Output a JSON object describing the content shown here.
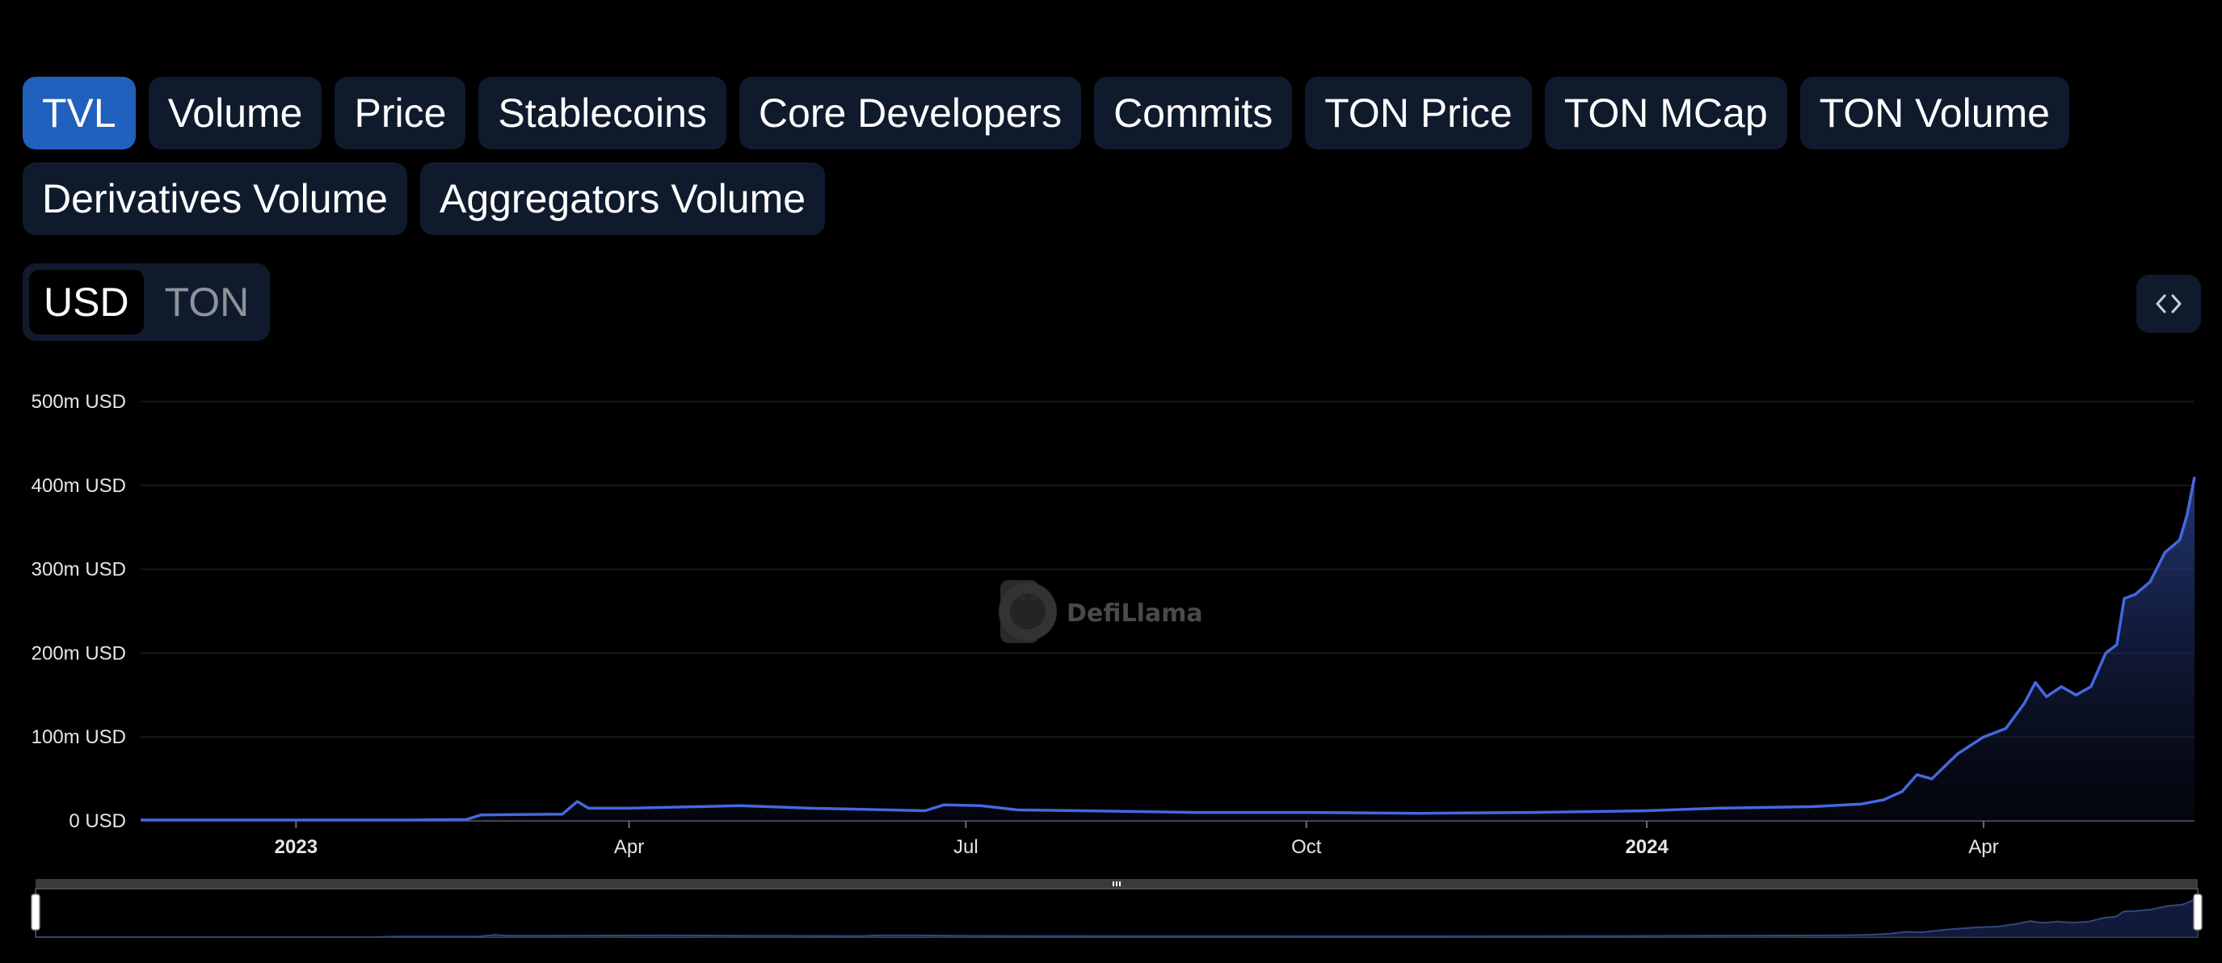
{
  "tabs": [
    {
      "label": "TVL",
      "active": true
    },
    {
      "label": "Volume",
      "active": false
    },
    {
      "label": "Price",
      "active": false
    },
    {
      "label": "Stablecoins",
      "active": false
    },
    {
      "label": "Core Developers",
      "active": false
    },
    {
      "label": "Commits",
      "active": false
    },
    {
      "label": "TON Price",
      "active": false
    },
    {
      "label": "TON MCap",
      "active": false
    },
    {
      "label": "TON Volume",
      "active": false
    },
    {
      "label": "Derivatives Volume",
      "active": false
    },
    {
      "label": "Aggregators Volume",
      "active": false
    }
  ],
  "unit_toggle": {
    "options": [
      "USD",
      "TON"
    ],
    "selected": "USD"
  },
  "embed_button": {
    "icon": "code-brackets-icon"
  },
  "watermark": {
    "text": "DefiLlama",
    "icon": "llama-logo-icon"
  },
  "colors": {
    "accent": "#2160bd",
    "line": "#4468e0",
    "tab_bg": "#0f1b2d",
    "grid": "#1f1f1f",
    "axis_text": "#e6e6e6"
  },
  "chart_data": {
    "type": "area",
    "title": "",
    "xlabel": "",
    "ylabel": "",
    "y_unit": "USD",
    "x_range": [
      "2022-11-20",
      "2024-05-28"
    ],
    "ylim": [
      0,
      500000000
    ],
    "y_ticks": [
      {
        "value": 0,
        "label": "0 USD"
      },
      {
        "value": 100000000,
        "label": "100m USD"
      },
      {
        "value": 200000000,
        "label": "200m USD"
      },
      {
        "value": 300000000,
        "label": "300m USD"
      },
      {
        "value": 400000000,
        "label": "400m USD"
      },
      {
        "value": 500000000,
        "label": "500m USD"
      }
    ],
    "x_ticks": [
      {
        "date": "2023-01-01",
        "label": "2023",
        "bold": true
      },
      {
        "date": "2023-04-01",
        "label": "Apr",
        "bold": false
      },
      {
        "date": "2023-07-01",
        "label": "Jul",
        "bold": false
      },
      {
        "date": "2023-10-01",
        "label": "Oct",
        "bold": false
      },
      {
        "date": "2024-01-01",
        "label": "2024",
        "bold": true
      },
      {
        "date": "2024-04-01",
        "label": "Apr",
        "bold": false
      }
    ],
    "grid": true,
    "legend": "none",
    "series": [
      {
        "values": [
          [
            "2022-11-20",
            1000000
          ],
          [
            "2023-01-01",
            1000000
          ],
          [
            "2023-02-01",
            1000000
          ],
          [
            "2023-02-16",
            1500000
          ],
          [
            "2023-02-20",
            7000000
          ],
          [
            "2023-03-14",
            8000000
          ],
          [
            "2023-03-18",
            23000000
          ],
          [
            "2023-03-21",
            15000000
          ],
          [
            "2023-04-01",
            15000000
          ],
          [
            "2023-05-01",
            18000000
          ],
          [
            "2023-05-20",
            15000000
          ],
          [
            "2023-06-20",
            12000000
          ],
          [
            "2023-06-25",
            19000000
          ],
          [
            "2023-07-05",
            18000000
          ],
          [
            "2023-07-15",
            13000000
          ],
          [
            "2023-08-01",
            12000000
          ],
          [
            "2023-09-01",
            10000000
          ],
          [
            "2023-10-01",
            10000000
          ],
          [
            "2023-11-01",
            9000000
          ],
          [
            "2023-12-01",
            10000000
          ],
          [
            "2024-01-01",
            12000000
          ],
          [
            "2024-01-20",
            15000000
          ],
          [
            "2024-02-15",
            17000000
          ],
          [
            "2024-02-28",
            20000000
          ],
          [
            "2024-03-05",
            25000000
          ],
          [
            "2024-03-10",
            35000000
          ],
          [
            "2024-03-14",
            55000000
          ],
          [
            "2024-03-18",
            50000000
          ],
          [
            "2024-03-25",
            80000000
          ],
          [
            "2024-04-01",
            100000000
          ],
          [
            "2024-04-07",
            110000000
          ],
          [
            "2024-04-12",
            140000000
          ],
          [
            "2024-04-15",
            165000000
          ],
          [
            "2024-04-18",
            148000000
          ],
          [
            "2024-04-22",
            160000000
          ],
          [
            "2024-04-26",
            150000000
          ],
          [
            "2024-04-30",
            160000000
          ],
          [
            "2024-05-04",
            200000000
          ],
          [
            "2024-05-07",
            210000000
          ],
          [
            "2024-05-09",
            265000000
          ],
          [
            "2024-05-12",
            270000000
          ],
          [
            "2024-05-16",
            285000000
          ],
          [
            "2024-05-20",
            320000000
          ],
          [
            "2024-05-24",
            335000000
          ],
          [
            "2024-05-26",
            365000000
          ],
          [
            "2024-05-28",
            410000000
          ]
        ]
      }
    ],
    "data_zoom": {
      "start_fraction": 0,
      "end_fraction": 1
    }
  }
}
